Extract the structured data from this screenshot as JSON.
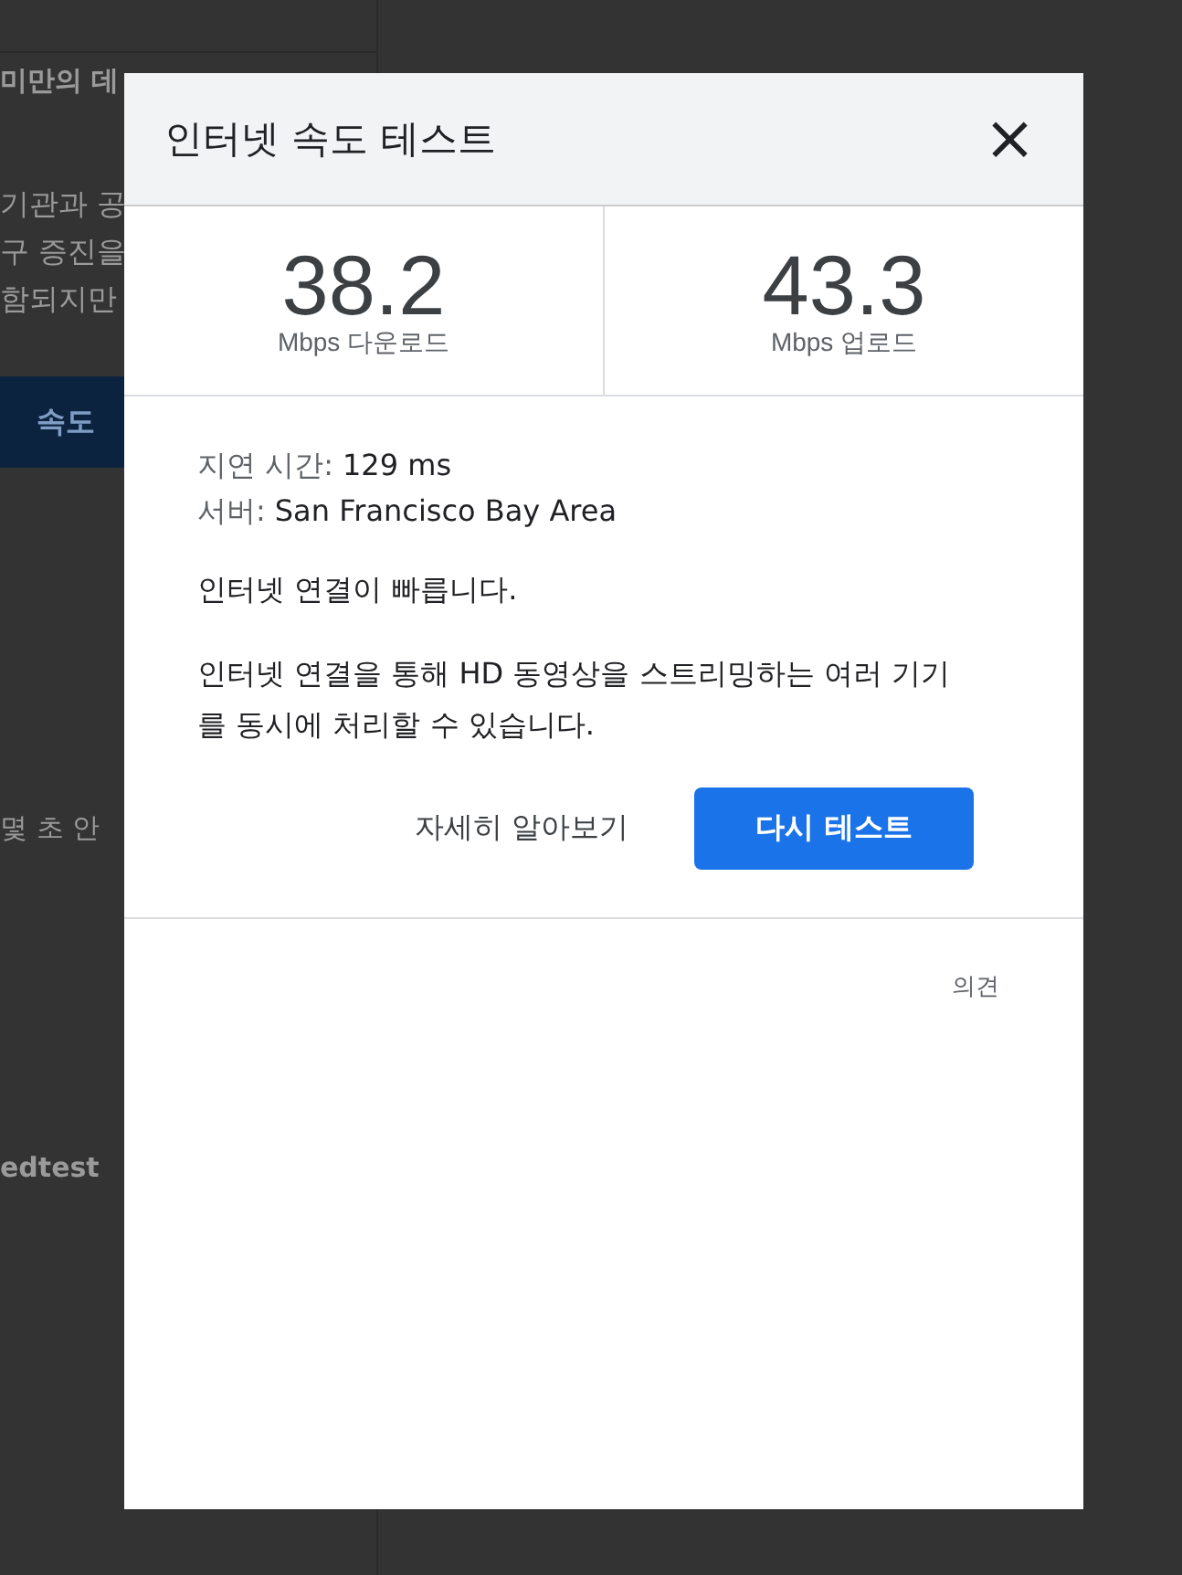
{
  "background_page": {
    "heading": "미만의 데",
    "paragraph_lines": [
      "기관과 공",
      "구 증진을",
      "함되지만"
    ],
    "button": "속도",
    "note": "몇 초 안",
    "footer_text": "edtest"
  },
  "dialog": {
    "title": "인터넷 속도 테스트",
    "close": "×",
    "speeds": [
      {
        "value": "38.2",
        "unit": "Mbps 다운로드"
      },
      {
        "value": "43.3",
        "unit": "Mbps 업로드"
      }
    ],
    "details": [
      {
        "label": "지연 시간:",
        "value": "129 ms"
      },
      {
        "label": "서버:",
        "value": "San Francisco Bay Area"
      }
    ],
    "summary": "인터넷 연결이 빠릅니다.",
    "description": "인터넷 연결을 통해 HD 동영상을 스트리밍하는 여러 기기를 동시에 처리할 수 있습니다.",
    "buttons": [
      {
        "label": "자세히 알아보기",
        "kind": "text"
      },
      {
        "label": "다시 테스트",
        "kind": "primary"
      }
    ],
    "feedback": "의견"
  }
}
